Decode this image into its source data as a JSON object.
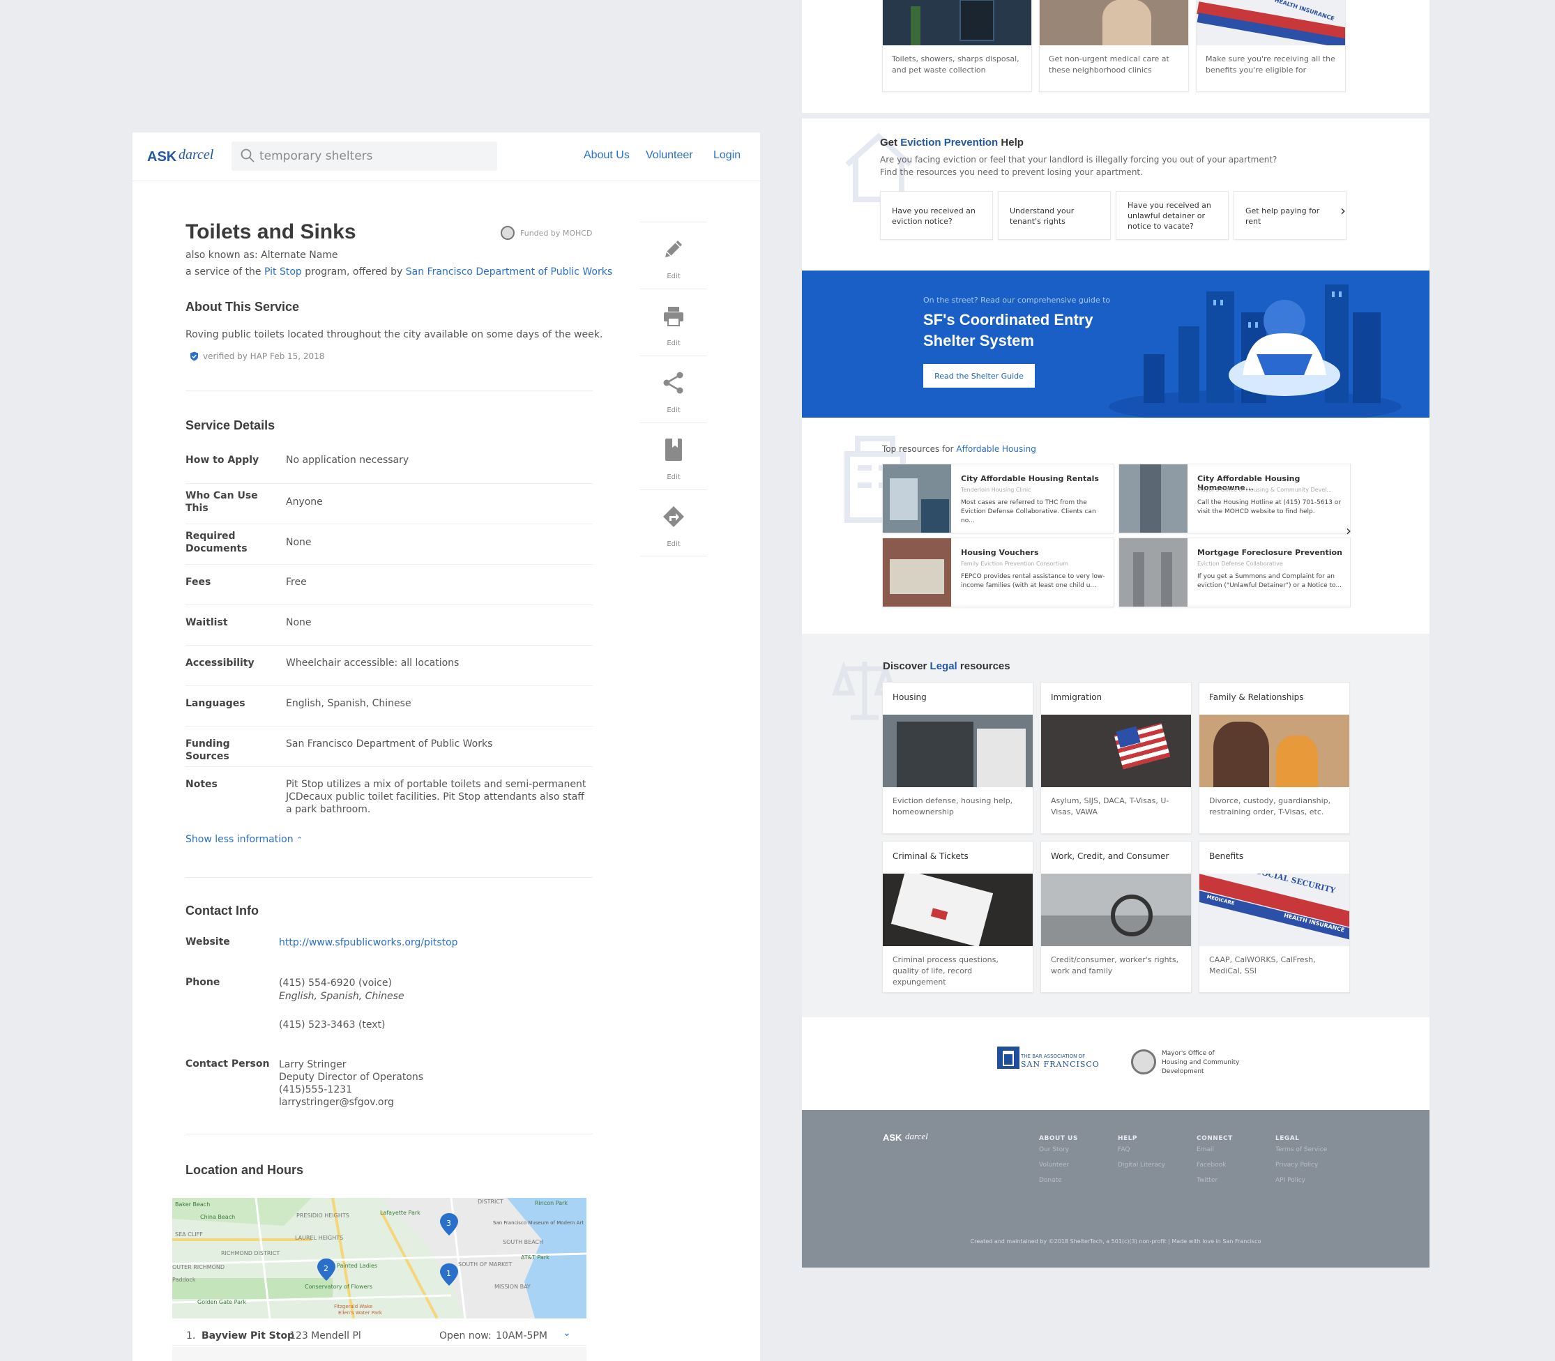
{
  "brand": {
    "ask": "ASK",
    "darcel": "darcel"
  },
  "search": {
    "placeholder": "temporary shelters"
  },
  "nav": {
    "about": "About Us",
    "volunteer": "Volunteer",
    "login": "Login"
  },
  "service": {
    "title": "Toilets and Sinks",
    "aka_prefix": "also known as:",
    "aka": "Alternate Name",
    "service_of_prefix": "a service of the",
    "program": "Pit Stop",
    "offered_by_text": "program, offered by",
    "provider": "San Francisco Department of Public Works",
    "funded_by": "Funded by MOHCD"
  },
  "about": {
    "heading": "About This Service",
    "description": "Roving public toilets located throughout the city available on some days of the week.",
    "verified": "verified by HAP Feb 15, 2018"
  },
  "details": {
    "heading": "Service Details",
    "rows": [
      {
        "label": "How to Apply",
        "value": "No application necessary"
      },
      {
        "label": "Who Can Use This",
        "value": "Anyone"
      },
      {
        "label": "Required Documents",
        "value": "None"
      },
      {
        "label": "Fees",
        "value": "Free"
      },
      {
        "label": "Waitlist",
        "value": "None"
      },
      {
        "label": "Accessibility",
        "value": "Wheelchair accessible: all locations"
      },
      {
        "label": "Languages",
        "value": "English, Spanish, Chinese"
      },
      {
        "label": "Funding Sources",
        "value": "San Francisco Department of Public Works"
      },
      {
        "label": "Notes",
        "value": "Pit Stop utilizes a mix of portable toilets and semi-permanent JCDecaux public toilet facilities. Pit Stop attendants also staff a park bathroom."
      }
    ],
    "show_less": "Show less information"
  },
  "contact": {
    "heading": "Contact Info",
    "website_label": "Website",
    "website": "http://www.sfpublicworks.org/pitstop",
    "phone_label": "Phone",
    "phone1": "(415) 554-6920 (voice)",
    "phone1_langs": "English, Spanish, Chinese",
    "phone2": "(415) 523-3463 (text)",
    "person_label": "Contact Person",
    "person_name": "Larry Stringer",
    "person_title": "Deputy Director of Operatons",
    "person_phone": "(415)555-1231",
    "person_email": "larrystringer@sfgov.org"
  },
  "actions": [
    {
      "icon": "pencil-icon",
      "label": "Edit"
    },
    {
      "icon": "printer-icon",
      "label": "Edit"
    },
    {
      "icon": "share-icon",
      "label": "Edit"
    },
    {
      "icon": "bookmark-icon",
      "label": "Edit"
    },
    {
      "icon": "directions-icon",
      "label": "Edit"
    }
  ],
  "location": {
    "heading": "Location and Hours",
    "map_labels": [
      "Baker Beach",
      "China Beach",
      "Lafayette Park",
      "DISTRICT",
      "Rincon Park",
      "PRESIDIO HEIGHTS",
      "SEA CLIFF",
      "LAUREL HEIGHTS",
      "San Francisco Museum of Modern Art",
      "SOUTH BEACH",
      "RICHMOND DISTRICT",
      "Painted Ladies",
      "AT&T Park",
      "OUTER RICHMOND",
      "Conservatory of Flowers",
      "SOUTH OF MARKET",
      "Golden Gate Park",
      "MISSION BAY",
      "Paddock",
      "Fitzgerald Wake",
      "Ellen's Water Park"
    ],
    "pins": [
      "3",
      "2",
      "1"
    ],
    "first_row": {
      "num": "1.",
      "name": "Bayview Pit Stop",
      "address": "123 Mendell Pl",
      "open_label": "Open now:",
      "hours": "10AM-5PM"
    }
  },
  "right": {
    "top_cards": [
      "Toilets, showers, sharps disposal, and pet waste collection",
      "Get non-urgent medical care at these neighborhood clinics",
      "Make sure you're receiving all the benefits you're eligible for"
    ],
    "top_card3_banner": "HEALTH INSURANCE",
    "eviction": {
      "get": "Get",
      "highlight": "Eviction Prevention",
      "help": "Help",
      "desc1": "Are you facing eviction or feel that your landlord is illegally forcing you out of your apartment?",
      "desc2": "Find the resources you need to prevent losing your apartment.",
      "cards": [
        "Have you received an eviction notice?",
        "Understand your tenant's rights",
        "Have you received an unlawful detainer or notice to vacate?",
        "Get help paying for rent"
      ]
    },
    "shelter": {
      "kicker": "On the street? Read our comprehensive guide to",
      "title1": "SF's Coordinated Entry",
      "title2": "Shelter System",
      "button": "Read the Shelter Guide"
    },
    "housing": {
      "prefix": "Top resources for",
      "highlight": "Affordable Housing",
      "items": [
        {
          "title": "City Affordable Housing Rentals",
          "org": "Tenderloin Housing Clinic",
          "desc": "Most cases are referred to THC from the Eviction Defense Collaborative. Clients can no..."
        },
        {
          "title": "City Affordable Housing Homeowne...",
          "org": "Mayor's Office of Housing & Community Devel...",
          "desc": "Call the Housing Hotline at (415) 701-5613 or visit the MOHCD website to find help."
        },
        {
          "title": "Housing Vouchers",
          "org": "Family Eviction Prevention Consortium",
          "desc": "FEPCO provides rental assistance to very low-income families (with at least one child u..."
        },
        {
          "title": "Mortgage Foreclosure Prevention",
          "org": "Eviction Defense Collaborative",
          "desc": "If you get a Summons and Complaint for an eviction (\"Unlawful Detainer\") or a Notice to..."
        }
      ]
    },
    "legal": {
      "prefix": "Discover",
      "highlight": "Legal",
      "suffix": "resources",
      "cards": [
        {
          "title": "Housing",
          "desc": "Eviction defense, housing help, homeownership"
        },
        {
          "title": "Immigration",
          "desc": "Asylum, SIJS, DACA, T-Visas, U-Visas, VAWA"
        },
        {
          "title": "Family & Relationships",
          "desc": "Divorce, custody, guardianship, restraining order, T-Visas, etc."
        },
        {
          "title": "Criminal & Tickets",
          "desc": "Criminal process questions, quality of life, record expungement"
        },
        {
          "title": "Work, Credit, and Consumer",
          "desc": "Credit/consumer, worker's rights, work and family"
        },
        {
          "title": "Benefits",
          "desc": "CAAP, CalWORKS, CalFresh, MediCal, SSI"
        }
      ],
      "benefits_banner1": "SOCIAL SECURITY",
      "benefits_banner2": "MEDICARE",
      "benefits_banner3": "HEALTH INSURANCE"
    },
    "partners": {
      "bar1": "THE BAR ASSOCIATION OF",
      "bar2": "SAN FRANCISCO",
      "mayor1": "Mayor's Office of",
      "mayor2": "Housing and Community",
      "mayor3": "Development"
    },
    "footer": {
      "cols": [
        {
          "heading": "ABOUT US",
          "items": [
            "Our Story",
            "Volunteer",
            "Donate"
          ]
        },
        {
          "heading": "HELP",
          "items": [
            "FAQ",
            "Digital Literacy"
          ]
        },
        {
          "heading": "CONNECT",
          "items": [
            "Email",
            "Facebook",
            "Twitter"
          ]
        },
        {
          "heading": "LEGAL",
          "items": [
            "Terms of Service",
            "Privacy Policy",
            "API Policy"
          ]
        }
      ],
      "credit": "Created and maintained by ©2018 ShelterTech, a 501(c)(3) non-profit | Made with love in San Francisco"
    }
  }
}
